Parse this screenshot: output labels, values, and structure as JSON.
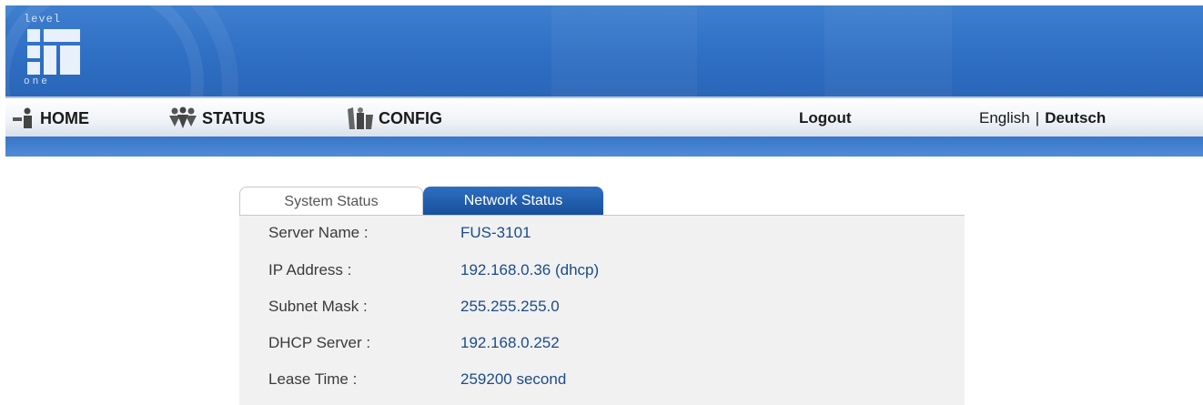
{
  "logo": {
    "top_text": "level",
    "bottom_text": "one"
  },
  "nav": {
    "home": "HOME",
    "status": "STATUS",
    "config": "CONFIG",
    "logout": "Logout",
    "lang_english": "English",
    "lang_separator": "|",
    "lang_deutsch": "Deutsch"
  },
  "tabs": {
    "system_status": "System Status",
    "network_status": "Network Status"
  },
  "network": {
    "rows": [
      {
        "label": "Server Name :",
        "value": "FUS-3101"
      },
      {
        "label": "IP Address :",
        "value": "192.168.0.36 (dhcp)"
      },
      {
        "label": "Subnet Mask :",
        "value": "255.255.255.0"
      },
      {
        "label": "DHCP Server :",
        "value": "192.168.0.252"
      },
      {
        "label": "Lease Time :",
        "value": "259200 second"
      }
    ]
  },
  "colors": {
    "banner": "#2f6fc4",
    "active_tab": "#1e5aa8",
    "value_text": "#1a4c8c",
    "panel_bg": "#f1f1f1"
  }
}
